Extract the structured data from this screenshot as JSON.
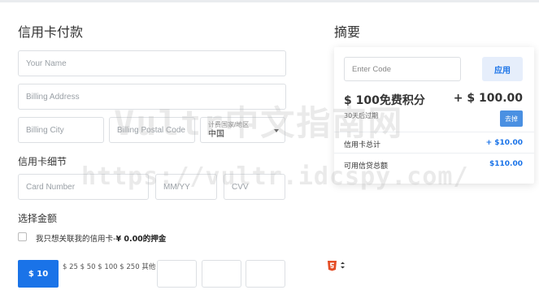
{
  "credit_card_section": {
    "title": "信用卡付款",
    "name_placeholder": "Your Name",
    "address_placeholder": "Billing Address",
    "city_placeholder": "Billing City",
    "postal_placeholder": "Billing Postal Code",
    "country_label": "计费国家/地区",
    "country_value": "中国"
  },
  "card_details": {
    "title": "信用卡细节",
    "card_number_placeholder": "Card Number",
    "expiry_placeholder": "MM/YY",
    "cvv_placeholder": "CVV"
  },
  "amount_section": {
    "title": "选择金额",
    "link_only_text": "我只想关联我的信用卡-",
    "deposit_text": "¥ 0.00的押金",
    "selected_amount": "$ 10",
    "amount_options": "$ 25 $ 50 $ 100 $ 250 其他"
  },
  "summary": {
    "title": "摘要",
    "code_placeholder": "Enter Code",
    "apply_label": "应用",
    "credit_title": "$ 100免费积分",
    "credit_amount": "+ $ 100.00",
    "expire_note": "30天后过期",
    "remove_label": "去掉",
    "card_total_label": "信用卡总计",
    "card_total_value": "+ $10.00",
    "available_label": "可用信贷总额",
    "available_value": "$110.00"
  },
  "watermark": {
    "line1": "Vultr中文指南网",
    "line2": "https://vultr.idcspy.com/"
  },
  "colors": {
    "accent": "#1a73e8",
    "apply_bg": "#e6eefb",
    "remove_bg": "#4a90e2",
    "html5_icon": "#e44d26"
  },
  "icons": {
    "extension_icon": "html5-icon"
  }
}
